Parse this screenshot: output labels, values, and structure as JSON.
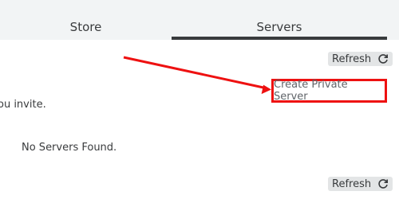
{
  "tabs": {
    "store_label": "Store",
    "servers_label": "Servers",
    "active": "Servers"
  },
  "refresh_top": {
    "label": "Refresh",
    "icon": "refresh-icon"
  },
  "create_private_server": {
    "label": "Create Private Server"
  },
  "invite_text": "ou invite.",
  "empty_state": "No Servers Found.",
  "refresh_bottom": {
    "label": "Refresh",
    "icon": "refresh-icon"
  },
  "annotation": {
    "type": "arrow",
    "color": "#ee1111",
    "target": "create_private_server"
  },
  "colors": {
    "tab_bar_bg": "#f2f4f5",
    "active_underline": "#393b3d",
    "highlight_box": "#ee1111",
    "refresh_bg": "#e3e5e6"
  }
}
